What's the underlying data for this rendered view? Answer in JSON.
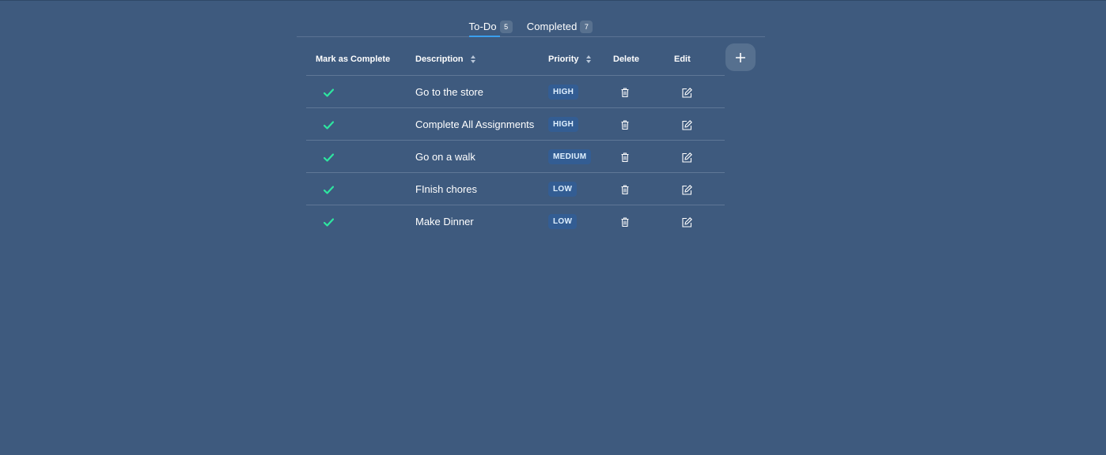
{
  "tabs": [
    {
      "label": "To-Do",
      "count": "5",
      "active": true
    },
    {
      "label": "Completed",
      "count": "7",
      "active": false
    }
  ],
  "table": {
    "headers": {
      "mark": "Mark as Complete",
      "description": "Description",
      "priority": "Priority",
      "delete": "Delete",
      "edit": "Edit"
    },
    "rows": [
      {
        "description": "Go to the store",
        "priority": "HIGH"
      },
      {
        "description": "Complete All Assignments",
        "priority": "HIGH"
      },
      {
        "description": "Go on a walk",
        "priority": "MEDIUM"
      },
      {
        "description": "FInish chores",
        "priority": "LOW"
      },
      {
        "description": "Make Dinner",
        "priority": "LOW"
      }
    ]
  },
  "icons": {
    "add": "plus-icon",
    "mark": "check-icon",
    "delete": "trash-icon",
    "edit": "edit-icon",
    "sort": "sort-icon"
  },
  "colors": {
    "background": "#3e5a7e",
    "check": "#2ee6a0",
    "badge_bg": "#335d93",
    "tab_indicator": "#3aa0ee"
  }
}
